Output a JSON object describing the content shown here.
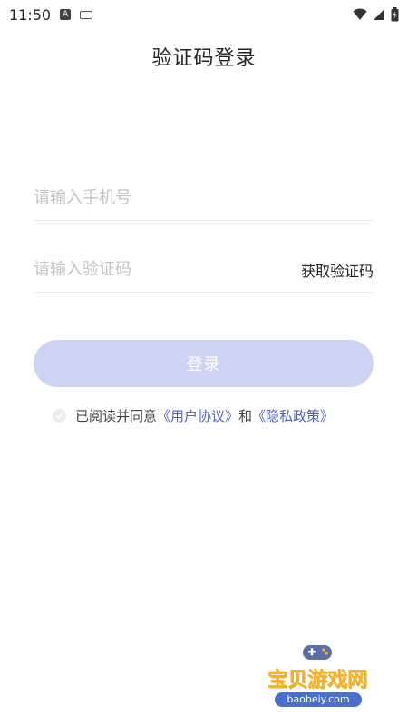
{
  "status_bar": {
    "time": "11:50",
    "badge": "A"
  },
  "page": {
    "title": "验证码登录"
  },
  "form": {
    "phone_placeholder": "请输入手机号",
    "code_placeholder": "请输入验证码",
    "get_code_label": "获取验证码",
    "login_label": "登录"
  },
  "agreement": {
    "prefix": "已阅读并同意",
    "user_agreement": "《用户协议》",
    "and": "和",
    "privacy_policy": "《隐私政策》"
  },
  "watermark": {
    "text": "宝贝游戏网",
    "url": "baobeiy.com"
  },
  "colors": {
    "primary_disabled": "#cdd3f3",
    "link": "#5561c6"
  }
}
